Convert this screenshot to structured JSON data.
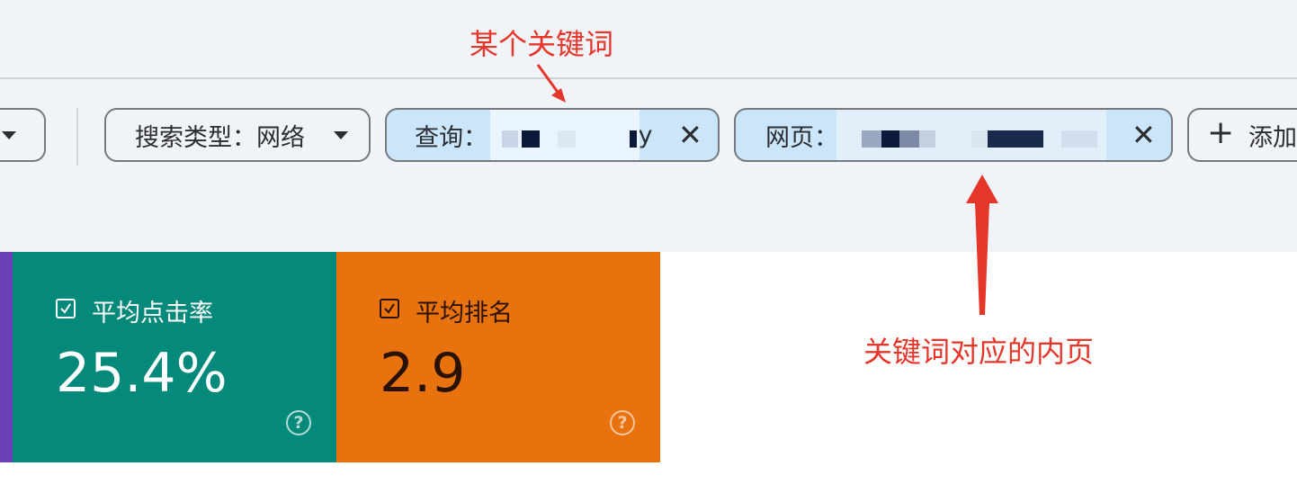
{
  "filters": {
    "search_type_label": "搜索类型：网络",
    "query_label": "查询：",
    "query_value_visible": "ly",
    "page_label": "网页：",
    "add_label": "添加",
    "close_glyph": "✕"
  },
  "metrics": [
    {
      "label": "平均点击率",
      "value": "25.4%",
      "bg": "#05897a",
      "fg": "#ffffff",
      "checked": true
    },
    {
      "label": "平均排名",
      "value": "2.9",
      "bg": "#e8720d",
      "fg": "#2a1200",
      "checked": true
    }
  ],
  "annotations": {
    "keyword": "某个关键词",
    "landing_page": "关键词对应的内页"
  },
  "colors": {
    "top_band": "#f0f3f8",
    "active_chip": "#cbe6fb",
    "annotation": "#e5362a",
    "ctr_card": "#05897a",
    "position_card": "#e8720d",
    "purple_card": "#6a3fb8"
  },
  "icons": [
    "dropdown-caret-icon",
    "close-icon",
    "plus-icon",
    "checkbox-checked-icon",
    "help-circle-icon",
    "arrow-icon"
  ]
}
